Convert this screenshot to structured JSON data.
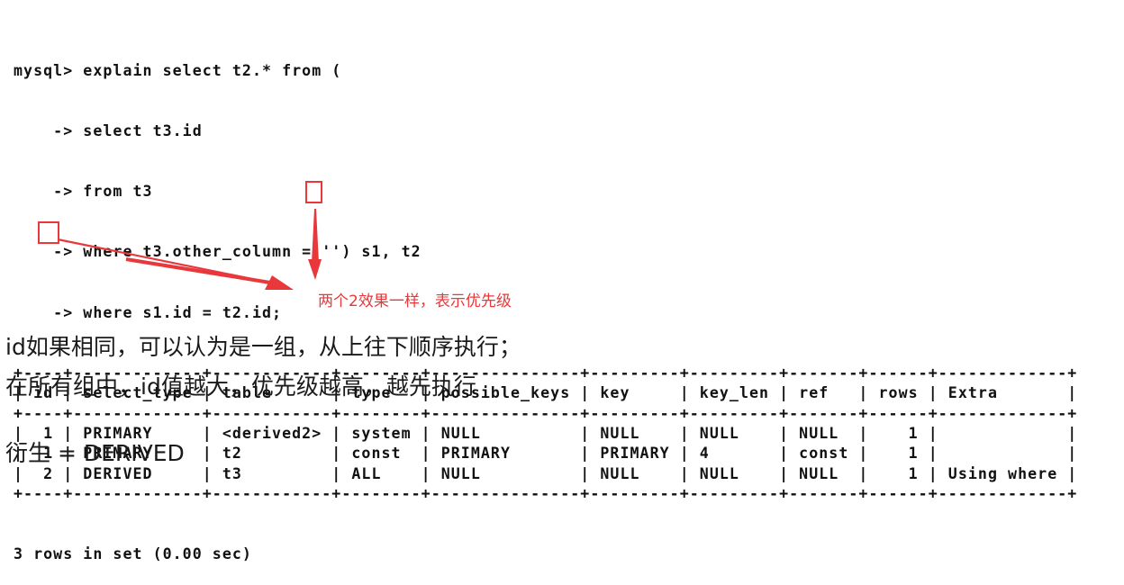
{
  "terminal": {
    "query_lines": [
      "mysql> explain select t2.* from (",
      "    -> select t3.id",
      "    -> from t3",
      "    -> where t3.other_column = '') s1, t2",
      "    -> where s1.id = t2.id;"
    ],
    "table": {
      "columns": [
        "id",
        "select_type",
        "table",
        "type",
        "possible_keys",
        "key",
        "key_len",
        "ref",
        "rows",
        "Extra"
      ],
      "rows": [
        [
          "1",
          "PRIMARY",
          "<derived2>",
          "system",
          "NULL",
          "NULL",
          "NULL",
          "NULL",
          "1",
          ""
        ],
        [
          "1",
          "PRIMARY",
          "t2",
          "const",
          "PRIMARY",
          "PRIMARY",
          "4",
          "const",
          "1",
          ""
        ],
        [
          "2",
          "DERIVED",
          "t3",
          "ALL",
          "NULL",
          "NULL",
          "NULL",
          "NULL",
          "1",
          "Using where"
        ]
      ]
    },
    "footer": "3 rows in set (0.00 sec)"
  },
  "annotation": {
    "note": "两个2效果一样，表示优先级",
    "color": "#e8383b"
  },
  "explanation": {
    "line1": "id如果相同，可以认为是一组，从上往下顺序执行；",
    "line2": "在所有组中，id值越大，优先级越高，越先执行",
    "line3": "衍生 = DERIVED"
  }
}
